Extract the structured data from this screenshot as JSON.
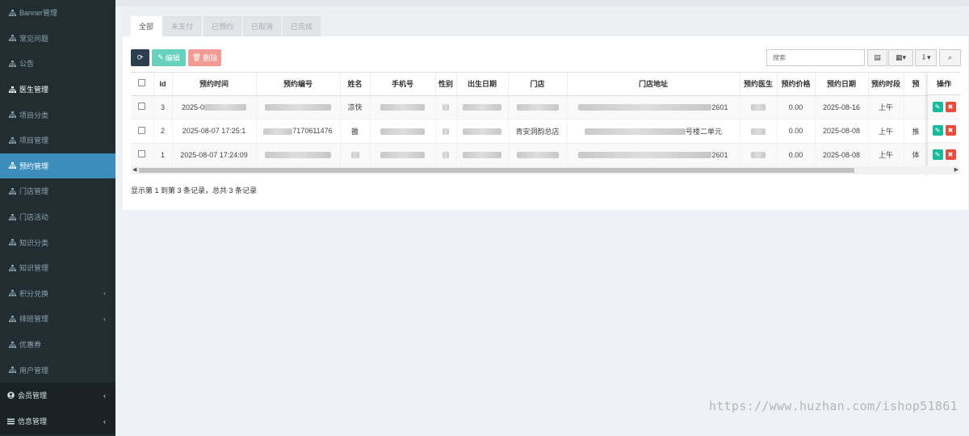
{
  "sidebar": {
    "items": [
      {
        "label": "Banner管理"
      },
      {
        "label": "常见问题"
      },
      {
        "label": "公告"
      },
      {
        "label": "医生管理"
      },
      {
        "label": "项目分类"
      },
      {
        "label": "项目管理"
      },
      {
        "label": "预约管理"
      },
      {
        "label": "门店管理"
      },
      {
        "label": "门店活动"
      },
      {
        "label": "知识分类"
      },
      {
        "label": "知识管理"
      },
      {
        "label": "积分兑换",
        "has_caret": true
      },
      {
        "label": "排班管理",
        "has_caret": true
      },
      {
        "label": "优惠券"
      },
      {
        "label": "用户管理"
      }
    ],
    "groups": [
      {
        "label": "会员管理"
      },
      {
        "label": "信息管理"
      }
    ],
    "active_color": "#3c8dbc"
  },
  "tabs": [
    "全部",
    "未支付",
    "已预约",
    "已取消",
    "已完成"
  ],
  "toolbar": {
    "edit_label": "编辑",
    "delete_label": "删除",
    "search_placeholder": "搜索"
  },
  "table": {
    "headers": [
      "Id",
      "预约时间",
      "预约编号",
      "姓名",
      "手机号",
      "性别",
      "出生日期",
      "门店",
      "门店地址",
      "预约医生",
      "预约价格",
      "预约日期",
      "预约时段",
      "预"
    ],
    "ops_header": "操作",
    "rows": [
      {
        "id": "3",
        "time": "2025-0",
        "no": "",
        "name": "凉快",
        "phone": "",
        "gender": "",
        "birth": "",
        "store": "",
        "addr_tail": "2601",
        "doctor": "",
        "price": "0.00",
        "date": "2025-08-16",
        "slot": "上午",
        "extra": ""
      },
      {
        "id": "2",
        "time": "2025-08-07 17:25:1",
        "no": "7170611476",
        "name": "雒",
        "phone": "",
        "gender": "",
        "birth": "",
        "store": "青安洞韵总店",
        "addr_tail": "号楼二单元",
        "doctor": "",
        "price": "0.00",
        "date": "2025-08-08",
        "slot": "上午",
        "extra": "推"
      },
      {
        "id": "1",
        "time": "2025-08-07 17:24:09",
        "no": "",
        "name": "",
        "phone": "",
        "gender": "",
        "birth": "",
        "store": "",
        "addr_tail": "2601",
        "doctor": "",
        "price": "0.00",
        "date": "2025-08-08",
        "slot": "上午",
        "extra": "体"
      }
    ]
  },
  "pagination": {
    "summary": "显示第 1 到第 3 条记录，总共 3 条记录"
  },
  "watermark": "https://www.huzhan.com/ishop51861"
}
